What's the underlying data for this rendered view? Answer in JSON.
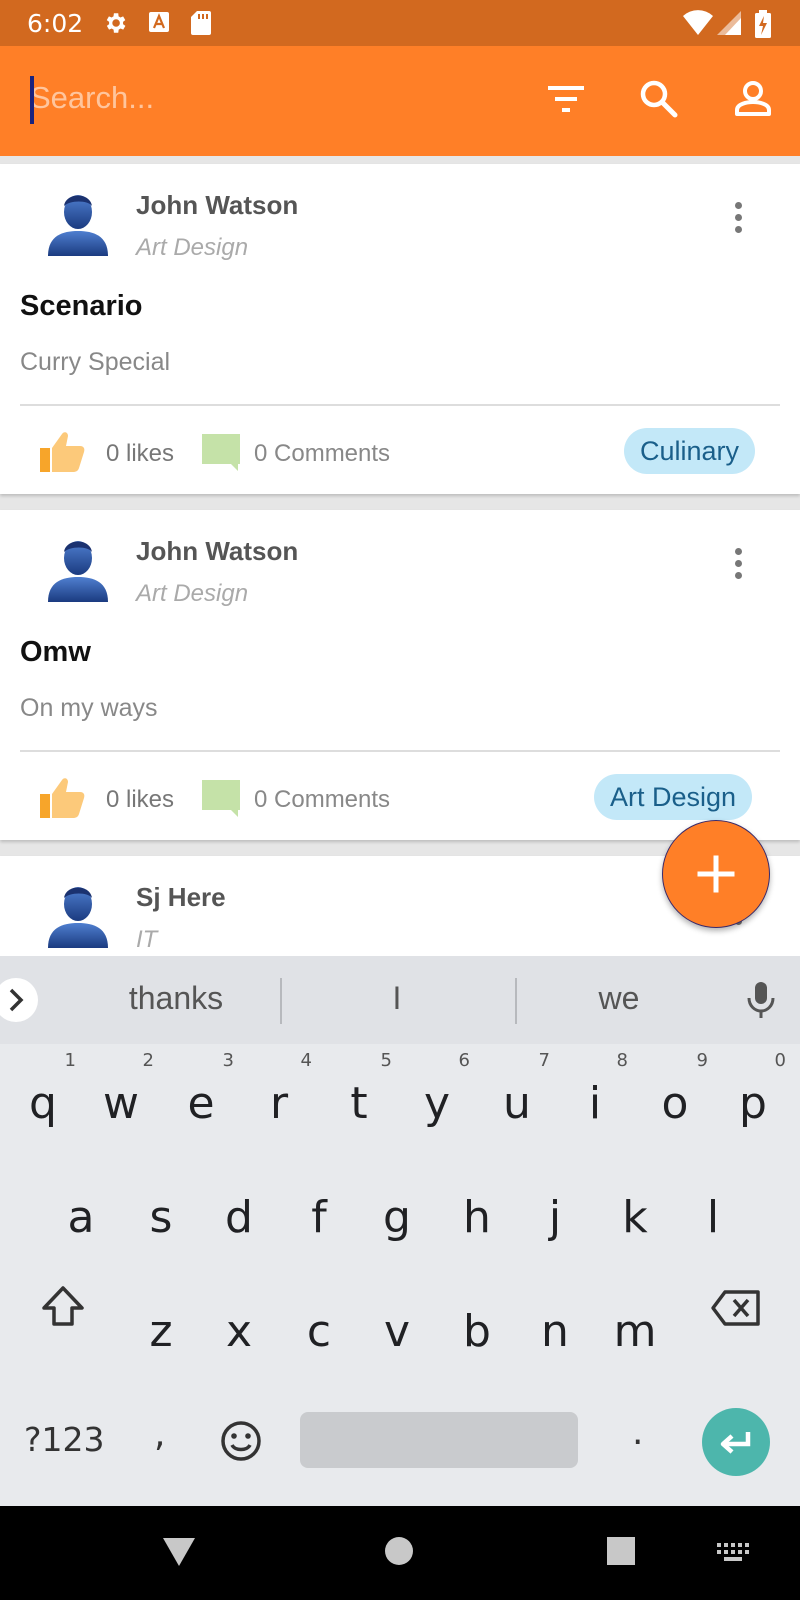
{
  "status_bar": {
    "time": "6:02",
    "icons": [
      "gear-icon",
      "a-notification-icon",
      "sd-card-icon",
      "wifi-icon",
      "signal-icon",
      "battery-charging-icon"
    ],
    "background": "#d2691f"
  },
  "app_bar": {
    "search_placeholder": "Search...",
    "search_value": "",
    "icons": [
      "filter-icon",
      "search-icon",
      "account-icon"
    ],
    "background": "#ff7f27"
  },
  "posts": [
    {
      "author": "John Watson",
      "category": "Art Design",
      "title": "Scenario",
      "body": "Curry Special",
      "likes": "0 likes",
      "comments": "0 Comments",
      "tag": "Culinary"
    },
    {
      "author": "John Watson",
      "category": "Art Design",
      "title": "Omw",
      "body": "On my ways",
      "likes": "0 likes",
      "comments": "0 Comments",
      "tag": "Art Design"
    },
    {
      "author": "Sj Here",
      "category": "IT"
    }
  ],
  "fab": {
    "icon": "plus-icon"
  },
  "keyboard": {
    "suggestions": [
      "thanks",
      "I",
      "we"
    ],
    "row1": [
      "q",
      "w",
      "e",
      "r",
      "t",
      "y",
      "u",
      "i",
      "o",
      "p"
    ],
    "row1_hints": [
      "1",
      "2",
      "3",
      "4",
      "5",
      "6",
      "7",
      "8",
      "9",
      "0"
    ],
    "row2": [
      "a",
      "s",
      "d",
      "f",
      "g",
      "h",
      "j",
      "k",
      "l"
    ],
    "row3": [
      "z",
      "x",
      "c",
      "v",
      "b",
      "n",
      "m"
    ],
    "symbols_label": "?123",
    "comma": ",",
    "period": ".",
    "accent": "#4db6ac"
  },
  "nav_bar": {
    "icons": [
      "back-icon",
      "home-icon",
      "recents-icon",
      "keyboard-switch-icon"
    ]
  }
}
